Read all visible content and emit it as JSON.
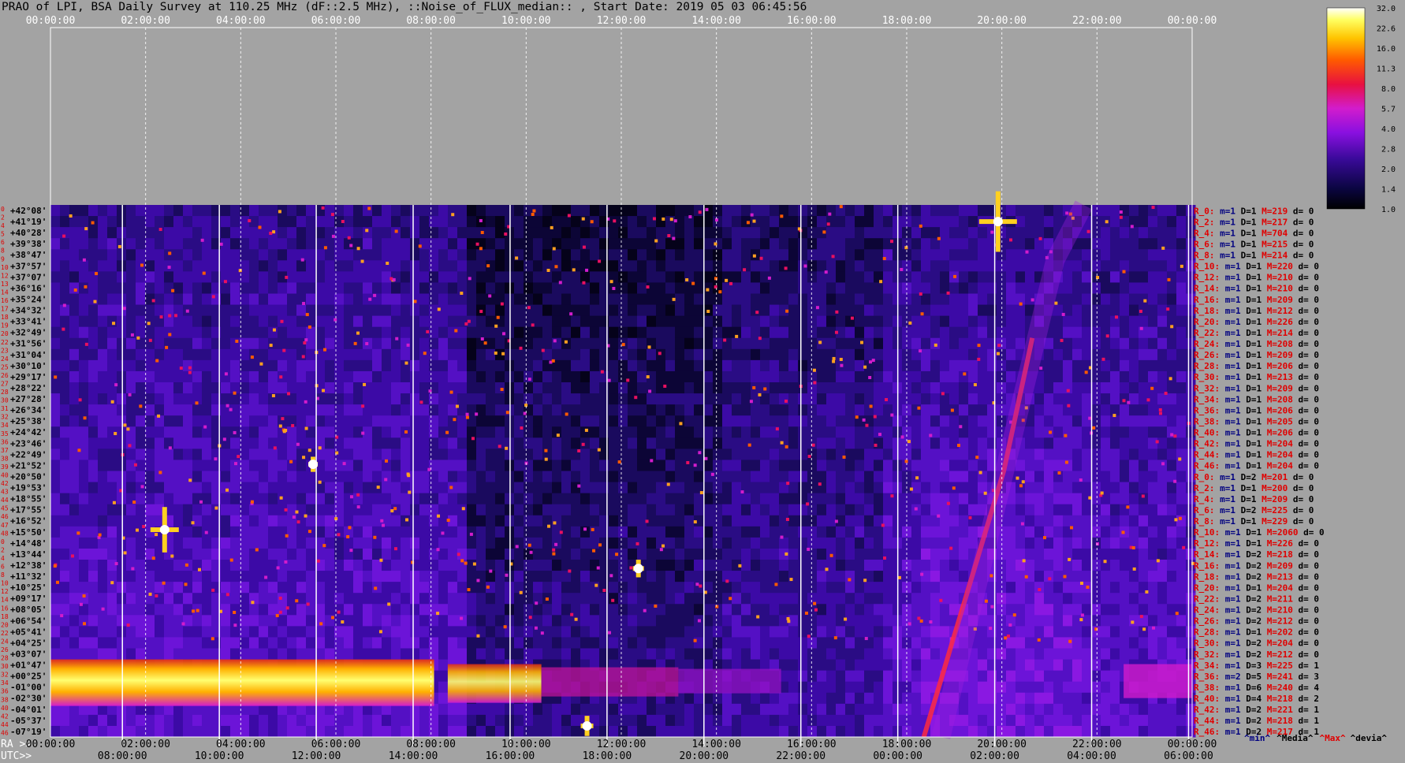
{
  "title": "PRAO of LPI, BSA Daily Survey at 110.25 MHz (dF::2.5 MHz), ::Noise_of_FLUX_median:: , Start Date: 2019 05 03 06:45:56",
  "chart_data": {
    "type": "heatmap",
    "top_time_ticks": [
      "00:00:00",
      "02:00:00",
      "04:00:00",
      "06:00:00",
      "08:00:00",
      "10:00:00",
      "12:00:00",
      "14:00:00",
      "16:00:00",
      "18:00:00",
      "20:00:00",
      "22:00:00",
      "00:00:00"
    ],
    "ra_label": "RA >>",
    "ra_ticks": [
      "00:00:00",
      "02:00:00",
      "04:00:00",
      "06:00:00",
      "08:00:00",
      "10:00:00",
      "12:00:00",
      "14:00:00",
      "16:00:00",
      "18:00:00",
      "20:00:00",
      "22:00:00",
      "00:00:00"
    ],
    "utc_label": "UTC>>",
    "utc_ticks": [
      "08:00:00",
      "10:00:00",
      "12:00:00",
      "14:00:00",
      "16:00:00",
      "18:00:00",
      "20:00:00",
      "22:00:00",
      "00:00:00",
      "02:00:00",
      "04:00:00",
      "06:00:00"
    ],
    "row_index_labels": [
      "0",
      "2",
      "4",
      "5",
      "6",
      "8",
      "9",
      "10",
      "12",
      "13",
      "14",
      "16",
      "17",
      "18",
      "19",
      "20",
      "22",
      "23",
      "24",
      "25",
      "26",
      "27",
      "28",
      "30",
      "31",
      "32",
      "34",
      "35",
      "36",
      "37",
      "38",
      "39",
      "40",
      "42",
      "43",
      "44",
      "45",
      "46",
      "47",
      "48",
      "0",
      "2",
      "4",
      "6",
      "8",
      "10",
      "12",
      "14",
      "16",
      "18",
      "20",
      "22",
      "24",
      "26",
      "28",
      "30",
      "32",
      "34",
      "36",
      "38",
      "40",
      "42",
      "44",
      "46"
    ],
    "declinations": [
      "+42°08'",
      "+41°19'",
      "+40°28'",
      "+39°38'",
      "+38°47'",
      "+37°57'",
      "+37°07'",
      "+36°16'",
      "+35°24'",
      "+34°32'",
      "+33°41'",
      "+32°49'",
      "+31°56'",
      "+31°04'",
      "+30°10'",
      "+29°17'",
      "+28°22'",
      "+27°28'",
      "+26°34'",
      "+25°38'",
      "+24°42'",
      "+23°46'",
      "+22°49'",
      "+21°52'",
      "+20°50'",
      "+19°53'",
      "+18°55'",
      "+17°55'",
      "+16°52'",
      "+15°50'",
      "+14°48'",
      "+13°44'",
      "+12°38'",
      "+11°32'",
      "+10°25'",
      "+09°17'",
      "+08°05'",
      "+06°54'",
      "+05°41'",
      "+04°25'",
      "+03°07'",
      "+01°47'",
      "+00°25'",
      "-01°00'",
      "-02°30'",
      "-04°01'",
      "-05°37'",
      "-07°19'"
    ],
    "colorbar": {
      "ticks": [
        "32.0",
        "22.6",
        "16.0",
        "11.3",
        "8.0",
        "5.7",
        "4.0",
        "2.8",
        "2.0",
        "1.4",
        "1.0"
      ],
      "scale": "log",
      "range": [
        1.0,
        32.0
      ]
    },
    "stats_rows": [
      {
        "ray": "R_0:",
        "m": "m=1",
        "D": "D=1",
        "M": "M=219",
        "d": "d= 0"
      },
      {
        "ray": "R_2:",
        "m": "m=1",
        "D": "D=1",
        "M": "M=217",
        "d": "d= 0"
      },
      {
        "ray": "R_4:",
        "m": "m=1",
        "D": "D=1",
        "M": "M=704",
        "d": "d= 0"
      },
      {
        "ray": "R_6:",
        "m": "m=1",
        "D": "D=1",
        "M": "M=215",
        "d": "d= 0"
      },
      {
        "ray": "R_8:",
        "m": "m=1",
        "D": "D=1",
        "M": "M=214",
        "d": "d= 0"
      },
      {
        "ray": "R_10:",
        "m": "m=1",
        "D": "D=1",
        "M": "M=220",
        "d": "d= 0"
      },
      {
        "ray": "R_12:",
        "m": "m=1",
        "D": "D=1",
        "M": "M=210",
        "d": "d= 0"
      },
      {
        "ray": "R_14:",
        "m": "m=1",
        "D": "D=1",
        "M": "M=210",
        "d": "d= 0"
      },
      {
        "ray": "R_16:",
        "m": "m=1",
        "D": "D=1",
        "M": "M=209",
        "d": "d= 0"
      },
      {
        "ray": "R_18:",
        "m": "m=1",
        "D": "D=1",
        "M": "M=212",
        "d": "d= 0"
      },
      {
        "ray": "R_20:",
        "m": "m=1",
        "D": "D=1",
        "M": "M=226",
        "d": "d= 0"
      },
      {
        "ray": "R_22:",
        "m": "m=1",
        "D": "D=1",
        "M": "M=214",
        "d": "d= 0"
      },
      {
        "ray": "R_24:",
        "m": "m=1",
        "D": "D=1",
        "M": "M=208",
        "d": "d= 0"
      },
      {
        "ray": "R_26:",
        "m": "m=1",
        "D": "D=1",
        "M": "M=209",
        "d": "d= 0"
      },
      {
        "ray": "R_28:",
        "m": "m=1",
        "D": "D=1",
        "M": "M=206",
        "d": "d= 0"
      },
      {
        "ray": "R_30:",
        "m": "m=1",
        "D": "D=1",
        "M": "M=213",
        "d": "d= 0"
      },
      {
        "ray": "R_32:",
        "m": "m=1",
        "D": "D=1",
        "M": "M=209",
        "d": "d= 0"
      },
      {
        "ray": "R_34:",
        "m": "m=1",
        "D": "D=1",
        "M": "M=208",
        "d": "d= 0"
      },
      {
        "ray": "R_36:",
        "m": "m=1",
        "D": "D=1",
        "M": "M=206",
        "d": "d= 0"
      },
      {
        "ray": "R_38:",
        "m": "m=1",
        "D": "D=1",
        "M": "M=205",
        "d": "d= 0"
      },
      {
        "ray": "R_40:",
        "m": "m=1",
        "D": "D=1",
        "M": "M=206",
        "d": "d= 0"
      },
      {
        "ray": "R_42:",
        "m": "m=1",
        "D": "D=1",
        "M": "M=204",
        "d": "d= 0"
      },
      {
        "ray": "R_44:",
        "m": "m=1",
        "D": "D=1",
        "M": "M=204",
        "d": "d= 0"
      },
      {
        "ray": "R_46:",
        "m": "m=1",
        "D": "D=1",
        "M": "M=204",
        "d": "d= 0"
      },
      {
        "ray": "R_0:",
        "m": "m=1",
        "D": "D=2",
        "M": "M=201",
        "d": "d= 0"
      },
      {
        "ray": "R_2:",
        "m": "m=1",
        "D": "D=1",
        "M": "M=200",
        "d": "d= 0"
      },
      {
        "ray": "R_4:",
        "m": "m=1",
        "D": "D=1",
        "M": "M=209",
        "d": "d= 0"
      },
      {
        "ray": "R_6:",
        "m": "m=1",
        "D": "D=2",
        "M": "M=225",
        "d": "d= 0"
      },
      {
        "ray": "R_8:",
        "m": "m=1",
        "D": "D=1",
        "M": "M=229",
        "d": "d= 0"
      },
      {
        "ray": "R_10:",
        "m": "m=1",
        "D": "D=1",
        "M": "M=2060",
        "d": "d= 0"
      },
      {
        "ray": "R_12:",
        "m": "m=1",
        "D": "D=1",
        "M": "M=226",
        "d": "d= 0"
      },
      {
        "ray": "R_14:",
        "m": "m=1",
        "D": "D=2",
        "M": "M=218",
        "d": "d= 0"
      },
      {
        "ray": "R_16:",
        "m": "m=1",
        "D": "D=2",
        "M": "M=209",
        "d": "d= 0"
      },
      {
        "ray": "R_18:",
        "m": "m=1",
        "D": "D=2",
        "M": "M=213",
        "d": "d= 0"
      },
      {
        "ray": "R_20:",
        "m": "m=1",
        "D": "D=1",
        "M": "M=204",
        "d": "d= 0"
      },
      {
        "ray": "R_22:",
        "m": "m=1",
        "D": "D=2",
        "M": "M=211",
        "d": "d= 0"
      },
      {
        "ray": "R_24:",
        "m": "m=1",
        "D": "D=2",
        "M": "M=210",
        "d": "d= 0"
      },
      {
        "ray": "R_26:",
        "m": "m=1",
        "D": "D=2",
        "M": "M=212",
        "d": "d= 0"
      },
      {
        "ray": "R_28:",
        "m": "m=1",
        "D": "D=1",
        "M": "M=202",
        "d": "d= 0"
      },
      {
        "ray": "R_30:",
        "m": "m=1",
        "D": "D=2",
        "M": "M=204",
        "d": "d= 0"
      },
      {
        "ray": "R_32:",
        "m": "m=1",
        "D": "D=2",
        "M": "M=212",
        "d": "d= 0"
      },
      {
        "ray": "R_34:",
        "m": "m=1",
        "D": "D=3",
        "M": "M=225",
        "d": "d= 1"
      },
      {
        "ray": "R_36:",
        "m": "m=2",
        "D": "D=5",
        "M": "M=241",
        "d": "d= 3"
      },
      {
        "ray": "R_38:",
        "m": "m=1",
        "D": "D=6",
        "M": "M=240",
        "d": "d= 4"
      },
      {
        "ray": "R_40:",
        "m": "m=1",
        "D": "D=4",
        "M": "M=218",
        "d": "d= 2"
      },
      {
        "ray": "R_42:",
        "m": "m=1",
        "D": "D=2",
        "M": "M=221",
        "d": "d= 1"
      },
      {
        "ray": "R_44:",
        "m": "m=1",
        "D": "D=2",
        "M": "M=218",
        "d": "d= 1"
      },
      {
        "ray": "R_46:",
        "m": "m=1",
        "D": "D=2",
        "M": "M=217",
        "d": "d= 1"
      }
    ],
    "stats_footer": {
      "min": "^min^",
      "median": "^Media^",
      "max": "^Max^",
      "deviation": "^devia^"
    }
  }
}
